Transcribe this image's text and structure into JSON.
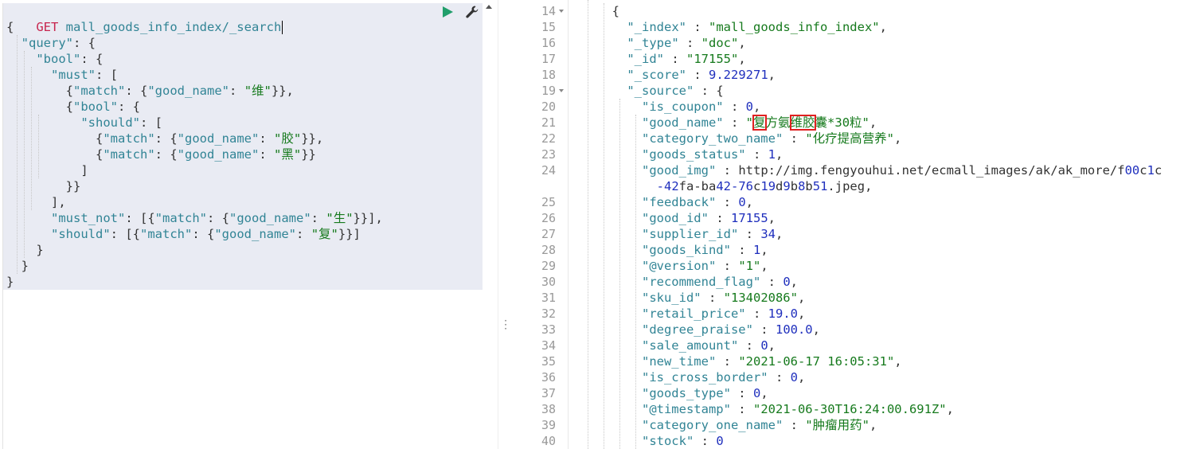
{
  "request": {
    "method": "GET",
    "url": "mall_goods_info_index/_search",
    "body_lines": [
      "{",
      "  \"query\": {",
      "    \"bool\": {",
      "      \"must\": [",
      "        {\"match\": {\"good_name\": \"维\"}},",
      "        {\"bool\": {",
      "          \"should\": [",
      "            {\"match\": {\"good_name\": \"胶\"}},",
      "            {\"match\": {\"good_name\": \"黑\"}}",
      "          ]",
      "        }}",
      "      ],",
      "      \"must_not\": [{\"match\": {\"good_name\": \"生\"}}],",
      "      \"should\": [{\"match\": {\"good_name\": \"复\"}}]",
      "    }",
      "  }",
      "}"
    ]
  },
  "toolbar": {
    "run_icon": "play-icon",
    "settings_icon": "wrench-icon"
  },
  "response": {
    "lines": [
      {
        "n": "14",
        "fold": true,
        "text": "        {"
      },
      {
        "n": "15",
        "fold": false,
        "text": "          \"_index\" : \"mall_goods_info_index\","
      },
      {
        "n": "16",
        "fold": false,
        "text": "          \"_type\" : \"doc\","
      },
      {
        "n": "17",
        "fold": false,
        "text": "          \"_id\" : \"17155\","
      },
      {
        "n": "18",
        "fold": false,
        "text": "          \"_score\" : 9.229271,"
      },
      {
        "n": "19",
        "fold": true,
        "text": "          \"_source\" : {"
      },
      {
        "n": "20",
        "fold": false,
        "text": "            \"is_coupon\" : 0,"
      },
      {
        "n": "21",
        "fold": false,
        "text": "            \"good_name\" : \"复方氨维胶囊*30粒\","
      },
      {
        "n": "22",
        "fold": false,
        "text": "            \"category_two_name\" : \"化疗提高营养\","
      },
      {
        "n": "23",
        "fold": false,
        "text": "            \"goods_status\" : 1,"
      },
      {
        "n": "24",
        "fold": false,
        "text": "            \"good_img\" : \"http://img.fengyouhui.net/ecmall_images/ak/ak_more/f00c1c"
      },
      {
        "n": "",
        "fold": false,
        "text": "              -42fa-ba42-76c19d9b8b51.jpeg\","
      },
      {
        "n": "25",
        "fold": false,
        "text": "            \"feedback\" : 0,"
      },
      {
        "n": "26",
        "fold": false,
        "text": "            \"good_id\" : 17155,"
      },
      {
        "n": "27",
        "fold": false,
        "text": "            \"supplier_id\" : 34,"
      },
      {
        "n": "28",
        "fold": false,
        "text": "            \"goods_kind\" : 1,"
      },
      {
        "n": "29",
        "fold": false,
        "text": "            \"@version\" : \"1\","
      },
      {
        "n": "30",
        "fold": false,
        "text": "            \"recommend_flag\" : 0,"
      },
      {
        "n": "31",
        "fold": false,
        "text": "            \"sku_id\" : \"13402086\","
      },
      {
        "n": "32",
        "fold": false,
        "text": "            \"retail_price\" : 19.0,"
      },
      {
        "n": "33",
        "fold": false,
        "text": "            \"degree_praise\" : 100.0,"
      },
      {
        "n": "34",
        "fold": false,
        "text": "            \"sale_amount\" : 0,"
      },
      {
        "n": "35",
        "fold": false,
        "text": "            \"new_time\" : \"2021-06-17 16:05:31\","
      },
      {
        "n": "36",
        "fold": false,
        "text": "            \"is_cross_border\" : 0,"
      },
      {
        "n": "37",
        "fold": false,
        "text": "            \"goods_type\" : 0,"
      },
      {
        "n": "38",
        "fold": false,
        "text": "            \"@timestamp\" : \"2021-06-30T16:24:00.691Z\","
      },
      {
        "n": "39",
        "fold": false,
        "text": "            \"category_one_name\" : \"肿瘤用药\","
      },
      {
        "n": "40",
        "fold": false,
        "text": "            \"stock\" : 0"
      }
    ],
    "highlight_chars": [
      "复",
      "维胶"
    ]
  },
  "colors": {
    "method": "#c7254e",
    "key": "#318495",
    "string": "#167a1d",
    "number": "#1f2fbd",
    "run_button": "#219e6b",
    "highlight_box": "#e02020",
    "request_bg": "#e9ebf3"
  }
}
